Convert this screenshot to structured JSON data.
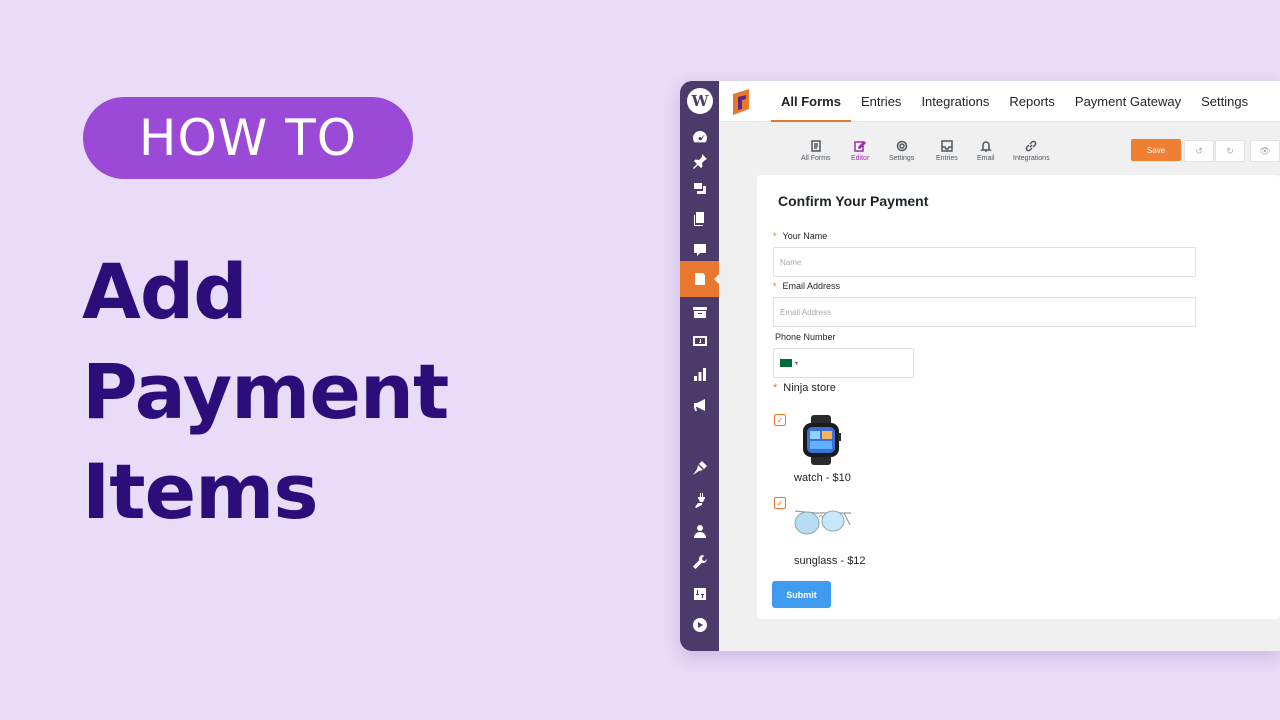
{
  "hero": {
    "badge": "HOW TO",
    "lines": [
      "Add",
      "Payment",
      "Items"
    ]
  },
  "nav": {
    "items": [
      "All Forms",
      "Entries",
      "Integrations",
      "Reports",
      "Payment Gateway",
      "Settings"
    ]
  },
  "toolbar": {
    "tools": [
      "All Forms",
      "Editor",
      "Settings",
      "Entries",
      "Email",
      "Integrations"
    ],
    "save_label": "Save"
  },
  "form": {
    "title": "Confirm Your Payment",
    "name_label": "Your Name",
    "name_placeholder": "Name",
    "email_label": "Email Address",
    "email_placeholder": "Email Address",
    "phone_label": "Phone Number",
    "store_label": "Ninja store",
    "products": [
      "watch - $10",
      "sunglass - $12"
    ],
    "submit_label": "Submit"
  },
  "colors": {
    "accent": "#e8782e",
    "sidebar": "#4b3b6a",
    "badge": "#9a4ad6",
    "headline": "#2c0d7a",
    "submit": "#3f9bf0"
  }
}
